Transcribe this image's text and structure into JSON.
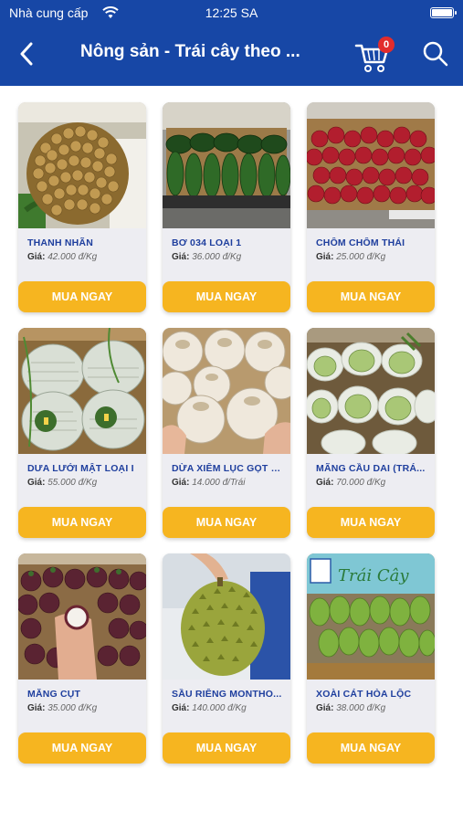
{
  "status": {
    "carrier": "Nhà cung cấp",
    "time": "12:25 SA"
  },
  "header": {
    "title": "Nông sản - Trái cây theo ...",
    "cart_count": "0"
  },
  "accent": "#1747a6",
  "button_color": "#f6b520",
  "products": [
    {
      "name": "THANH NHÃN",
      "price_label": "Giá:",
      "price": "42.000 đ/Kg",
      "buy_label": "MUA NGAY",
      "image": "longan-photo"
    },
    {
      "name": "BƠ 034 LOẠI 1",
      "price_label": "Giá:",
      "price": "36.000 đ/Kg",
      "buy_label": "MUA NGAY",
      "image": "avocado-photo"
    },
    {
      "name": "CHÔM CHÔM THÁI",
      "price_label": "Giá:",
      "price": "25.000 đ/Kg",
      "buy_label": "MUA NGAY",
      "image": "rambutan-photo"
    },
    {
      "name": "DƯA LƯỚI MẬT LOẠI I",
      "price_label": "Giá:",
      "price": "55.000 đ/Kg",
      "buy_label": "MUA NGAY",
      "image": "melon-photo"
    },
    {
      "name": "DỪA XIÊM LỤC GỌT VỎ",
      "price_label": "Giá:",
      "price": "14.000 đ/Trái",
      "buy_label": "MUA NGAY",
      "image": "coconut-photo"
    },
    {
      "name": "MÃNG CẦU DAI (TRÁ...",
      "price_label": "Giá:",
      "price": "70.000 đ/Kg",
      "buy_label": "MUA NGAY",
      "image": "custard-apple-photo"
    },
    {
      "name": "MĂNG CỤT",
      "price_label": "Giá:",
      "price": "35.000 đ/Kg",
      "buy_label": "MUA NGAY",
      "image": "mangosteen-photo"
    },
    {
      "name": "SẦU RIÊNG MONTHO...",
      "price_label": "Giá:",
      "price": "140.000 đ/Kg",
      "buy_label": "MUA NGAY",
      "image": "durian-photo"
    },
    {
      "name": "XOÀI CÁT HÒA LỘC",
      "price_label": "Giá:",
      "price": "38.000 đ/Kg",
      "buy_label": "MUA NGAY",
      "image": "mango-photo"
    }
  ],
  "signboard_text": "Trái Cây"
}
